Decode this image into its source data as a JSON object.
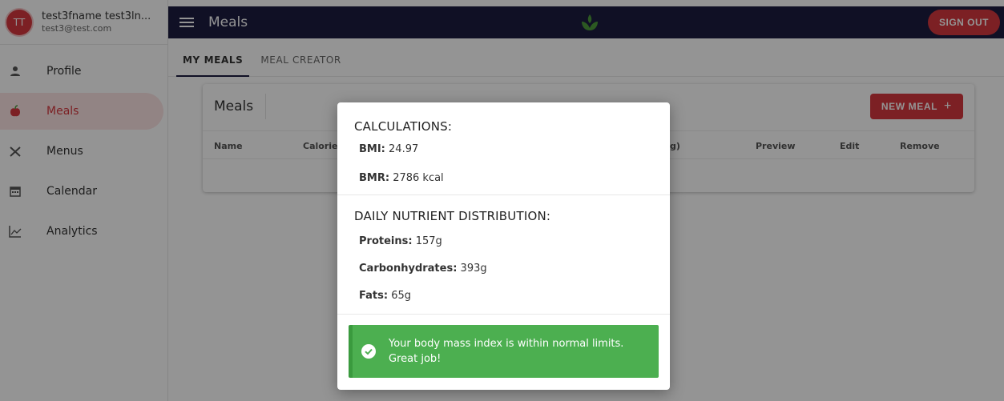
{
  "user": {
    "initials": "TT",
    "name": "test3fname test3ln...",
    "email": "test3@test.com"
  },
  "sidebar": {
    "items": [
      {
        "label": "Profile",
        "icon": "person-icon",
        "active": false
      },
      {
        "label": "Meals",
        "icon": "apple-icon",
        "active": true
      },
      {
        "label": "Menus",
        "icon": "utensils-icon",
        "active": false
      },
      {
        "label": "Calendar",
        "icon": "calendar-icon",
        "active": false
      },
      {
        "label": "Analytics",
        "icon": "chart-line-icon",
        "active": false
      }
    ]
  },
  "topbar": {
    "title": "Meals",
    "sign_out_label": "SIGN OUT"
  },
  "tabs": [
    {
      "label": "MY MEALS",
      "active": true
    },
    {
      "label": "MEAL CREATOR",
      "active": false
    }
  ],
  "card": {
    "title": "Meals",
    "new_meal_label": "NEW MEAL",
    "new_meal_icon": "+",
    "columns": [
      "Name",
      "Calories",
      "(g)",
      "Preview",
      "Edit",
      "Remove"
    ]
  },
  "modal": {
    "calc_title": "CALCULATIONS:",
    "bmi_label": "BMI:",
    "bmi_value": "24.97",
    "bmr_label": "BMR:",
    "bmr_value": "2786 kcal",
    "dist_title": "DAILY NUTRIENT DISTRIBUTION:",
    "proteins_label": "Proteins:",
    "proteins_value": "157g",
    "carbs_label": "Carbonhydrates:",
    "carbs_value": "393g",
    "fats_label": "Fats:",
    "fats_value": "65g",
    "alert_text": "Your body mass index is within normal limits. Great job!"
  },
  "colors": {
    "brand_red": "#d6383e",
    "topbar_navy": "#1c1c40",
    "success_green": "#4caf50",
    "logo_green": "#4c9a3b"
  }
}
